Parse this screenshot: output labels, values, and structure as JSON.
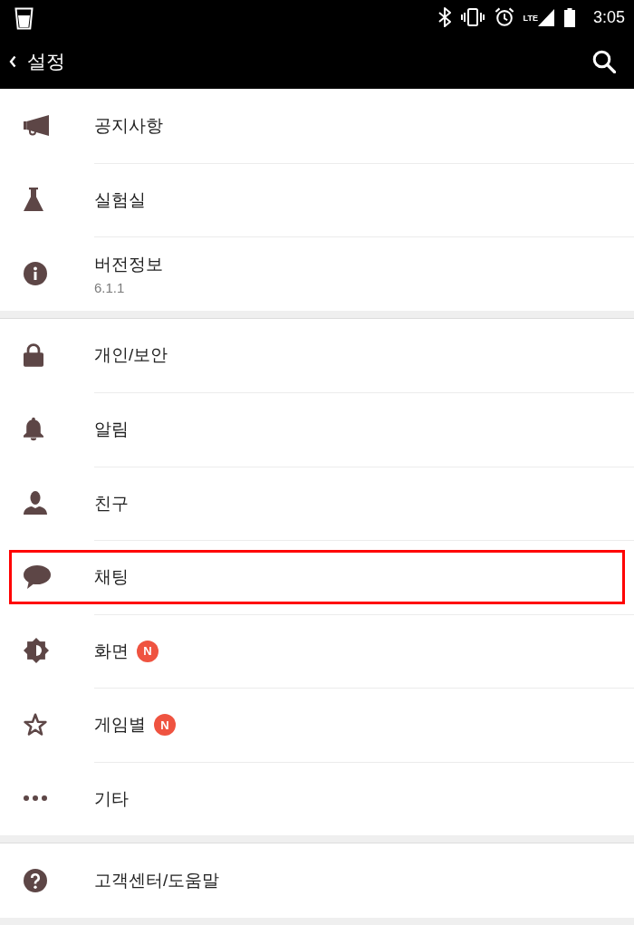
{
  "status_bar": {
    "network": "LTE",
    "time": "3:05"
  },
  "app_bar": {
    "title": "설정"
  },
  "sections": [
    {
      "items": [
        {
          "label": "공지사항",
          "highlighted": false
        },
        {
          "label": "실험실",
          "highlighted": false
        },
        {
          "label": "버전정보",
          "detail": "6.1.1",
          "highlighted": false
        }
      ]
    },
    {
      "items": [
        {
          "label": "개인/보안",
          "highlighted": false
        },
        {
          "label": "알림",
          "highlighted": false
        },
        {
          "label": "친구",
          "highlighted": false
        },
        {
          "label": "채팅",
          "highlighted": true
        },
        {
          "label": "화면",
          "badge": "N",
          "highlighted": false
        },
        {
          "label": "게임별",
          "badge": "N",
          "highlighted": false
        },
        {
          "label": "기타",
          "highlighted": false
        }
      ]
    },
    {
      "items": [
        {
          "label": "고객센터/도움말",
          "highlighted": false
        }
      ]
    }
  ]
}
